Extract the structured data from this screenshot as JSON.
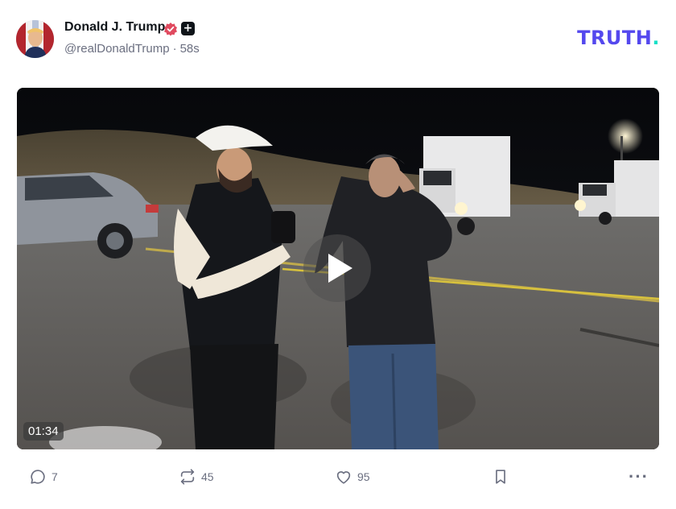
{
  "post": {
    "author_name": "Donald J. Trump",
    "handle": "@realDonaldTrump",
    "separator": "·",
    "time_ago": "58s"
  },
  "brand": {
    "logo_text": "TRUTH",
    "logo_dot": ".",
    "logo_color": "#5448ee",
    "dot_color": "#17e0c7"
  },
  "video": {
    "duration": "01:34"
  },
  "actions": {
    "replies": "7",
    "reposts": "45",
    "likes": "95"
  },
  "icons": {
    "verified": "verified-badge-icon",
    "plus": "plus-badge-icon",
    "reply": "reply-icon",
    "repost": "repost-icon",
    "like": "heart-icon",
    "bookmark": "bookmark-icon",
    "more": "more-icon",
    "play": "play-icon"
  },
  "colors": {
    "verified": "#e04a5f",
    "muted_text": "#6b6f80"
  }
}
